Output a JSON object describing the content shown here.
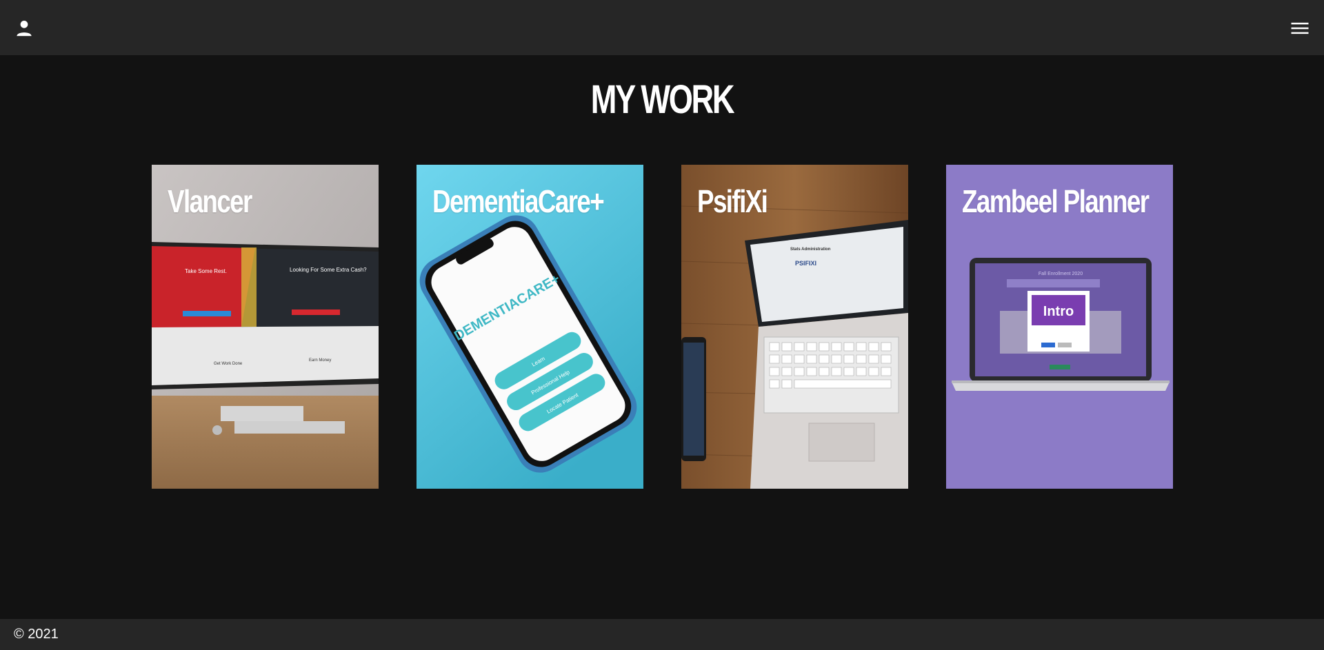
{
  "header": {
    "user_icon": "person-icon",
    "menu_icon": "hamburger-menu-icon"
  },
  "main": {
    "title": "MY WORK",
    "projects": [
      {
        "title": "Vlancer",
        "bg": "#bdb8b6",
        "screen": {
          "left_text": "Take Some Rest.",
          "right_text": "Looking For Some Extra Cash?",
          "bottom_left": "Get Work Done",
          "bottom_right": "Earn Money"
        }
      },
      {
        "title": "DementiaCare+",
        "bg": "#5ecde6",
        "screen": {
          "logo": "DEMENTIACARE+",
          "buttons": [
            "Learn",
            "Professional Help",
            "Locate Patient"
          ]
        }
      },
      {
        "title": "PsifiXi",
        "bg": "#8a5a34",
        "screen": {
          "heading": "Stats Administration",
          "logo": "PSIFIXI"
        }
      },
      {
        "title": "Zambeel Planner",
        "bg": "#8c7bc7",
        "screen": {
          "heading": "Fall Enrollment 2020",
          "modal_title": "Intro"
        }
      }
    ]
  },
  "footer": {
    "copyright": "© 2021"
  },
  "colors": {
    "topbar": "#262626",
    "background": "#121212",
    "footer": "#262626"
  }
}
